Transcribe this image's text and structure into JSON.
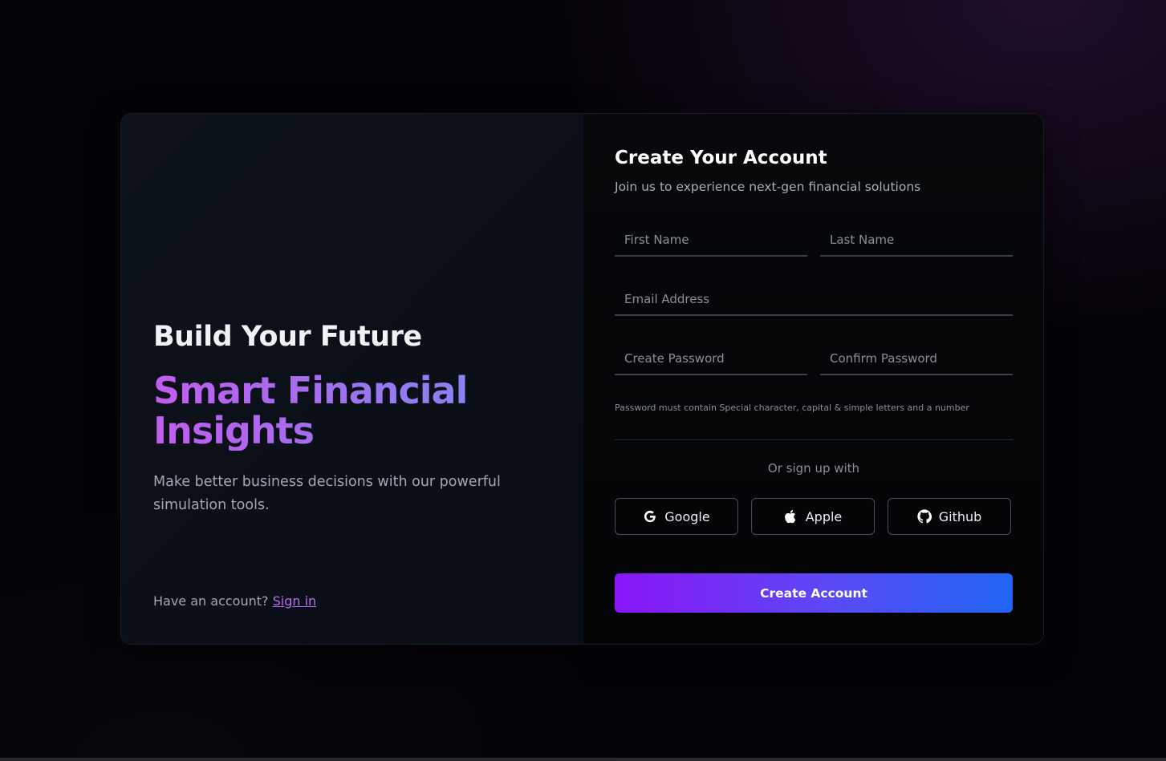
{
  "hero": {
    "headline": "Build Your Future",
    "title": "Smart Financial Insights",
    "description": "Make better business decisions with our powerful simulation tools.",
    "signin_prompt": "Have an account?",
    "signin_link": "Sign in"
  },
  "form": {
    "title": "Create Your Account",
    "subtitle": "Join us to experience next-gen financial solutions",
    "fields": {
      "first_name": {
        "placeholder": "First Name",
        "value": ""
      },
      "last_name": {
        "placeholder": "Last Name",
        "value": ""
      },
      "email": {
        "placeholder": "Email Address",
        "value": ""
      },
      "password": {
        "placeholder": "Create Password",
        "value": ""
      },
      "confirm_password": {
        "placeholder": "Confirm Password",
        "value": ""
      }
    },
    "password_hint": "Password must contain Special character, capital & simple letters and a number",
    "divider_text": "Or sign up with",
    "social": {
      "google": {
        "label": "Google",
        "icon": "google-icon"
      },
      "apple": {
        "label": "Apple",
        "icon": "apple-icon"
      },
      "github": {
        "label": "Github",
        "icon": "github-icon"
      }
    },
    "submit_label": "Create Account"
  },
  "colors": {
    "accent_purple": "#8a16f7",
    "accent_blue": "#2166f5",
    "link": "#b968f2",
    "gradient_text_start": "#c35cf0",
    "gradient_text_end": "#7f8cf4"
  }
}
